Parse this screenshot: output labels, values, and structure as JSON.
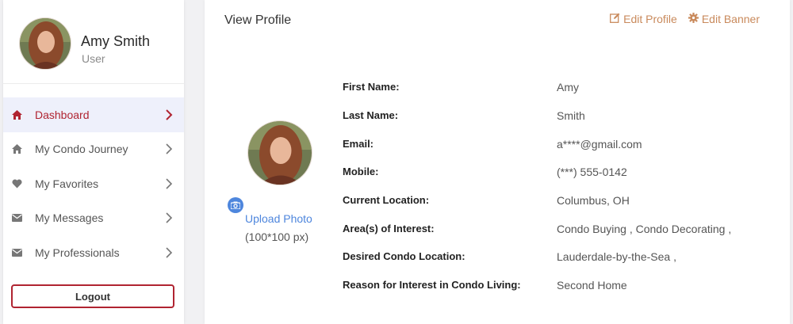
{
  "user": {
    "name": "Amy Smith",
    "role": "User"
  },
  "nav": {
    "items": [
      {
        "label": "Dashboard"
      },
      {
        "label": "My Condo Journey"
      },
      {
        "label": "My Favorites"
      },
      {
        "label": "My Messages"
      },
      {
        "label": "My Professionals"
      }
    ],
    "active_index": 0,
    "logout_label": "Logout"
  },
  "main": {
    "title": "View Profile",
    "actions": {
      "edit_profile": "Edit Profile",
      "edit_banner": "Edit Banner"
    },
    "upload": {
      "label": "Upload Photo",
      "hint": "(100*100 px)"
    },
    "fields": [
      {
        "label": "First Name:",
        "value": "Amy"
      },
      {
        "label": "Last Name:",
        "value": "Smith"
      },
      {
        "label": "Email:",
        "value": "a****@gmail.com"
      },
      {
        "label": "Mobile:",
        "value": "(***) 555-0142"
      },
      {
        "label": "Current Location:",
        "value": "Columbus, OH"
      },
      {
        "label": "Area(s) of Interest:",
        "value": "Condo Buying , Condo Decorating ,"
      },
      {
        "label": "Desired Condo Location:",
        "value": "Lauderdale-by-the-Sea ,"
      },
      {
        "label": "Reason for Interest in Condo Living:",
        "value": "Second Home"
      }
    ]
  },
  "icons": {
    "nav": [
      "home-icon",
      "home-icon",
      "heart-icon",
      "envelope-icon",
      "envelope-icon"
    ],
    "edit_profile": "edit-icon",
    "edit_banner": "gear-icon",
    "upload": "camera-icon"
  },
  "colors": {
    "accent_red": "#b02431",
    "active_bg": "#eef0fb",
    "action_orange": "#c98a5c",
    "link_blue": "#4e86dd"
  }
}
